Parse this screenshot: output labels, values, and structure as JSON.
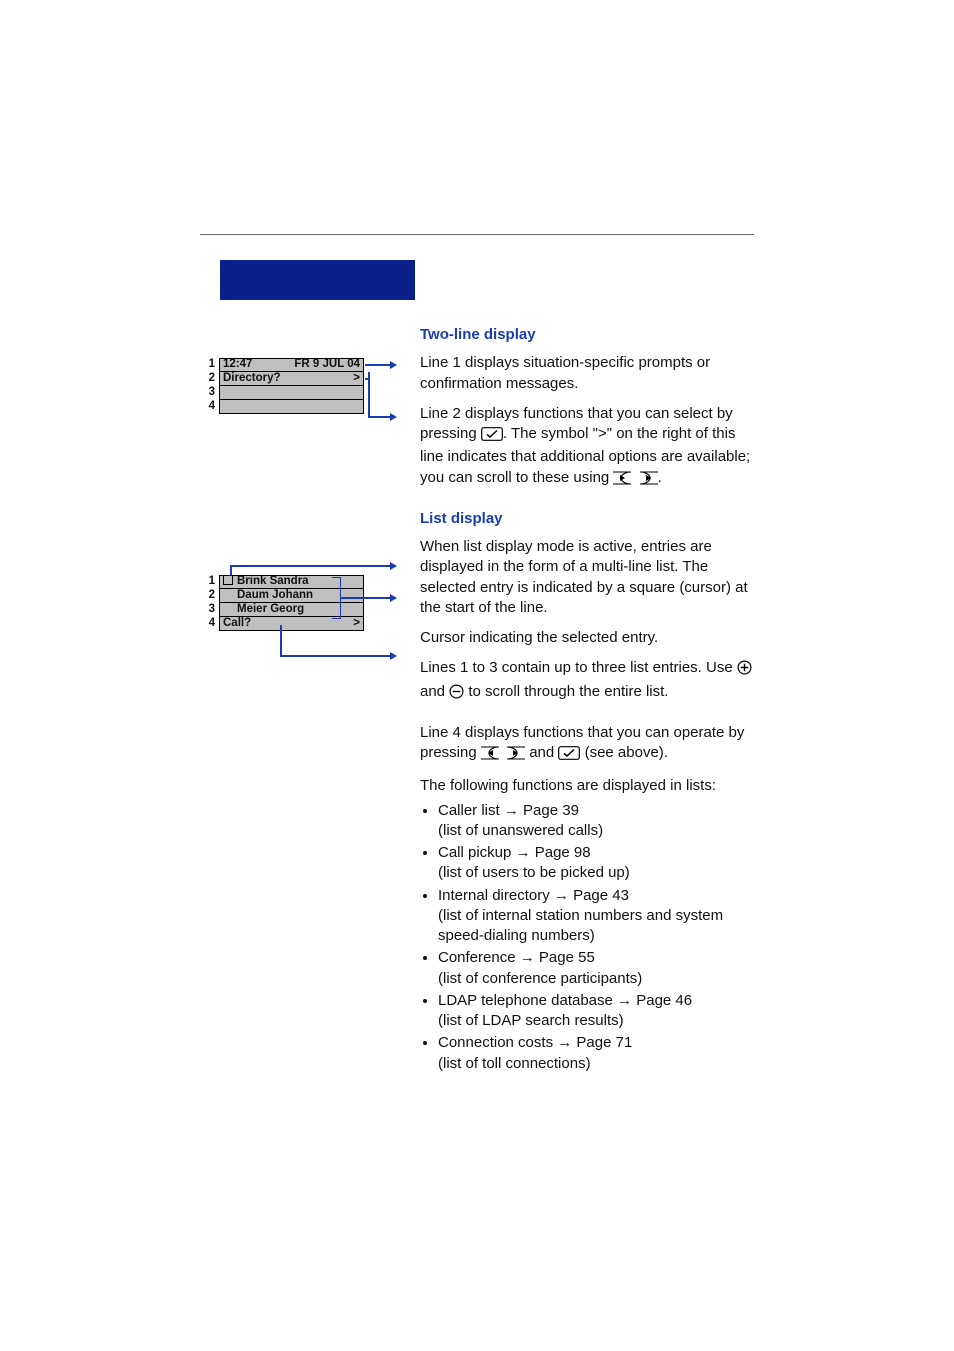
{
  "headings": {
    "two_line": "Two-line display",
    "list_display": "List display"
  },
  "two_line": {
    "p1": "Line 1 displays situation-specific prompts or confirmation messages.",
    "p2a": "Line 2 displays functions that you can select by pressing ",
    "p2b": ". The symbol \">\" on the right of this line indicates that additional options are available; you can scroll to these using ",
    "p2c": "."
  },
  "list": {
    "intro": "When list display mode is active, entries are displayed in the form of a multi-line list. The selected entry is indicated by a square (cursor) at the start of the line.",
    "cursor_note": "Cursor indicating the selected entry.",
    "lines_a": "Lines 1 to 3 contain up to three list entries. Use ",
    "lines_b": " and ",
    "lines_c": " to scroll through the entire list.",
    "line4_a": "Line 4 displays functions that you can operate by pressing ",
    "line4_b": " and ",
    "line4_c": " (see above).",
    "funcs_lead": "The following functions are displayed in lists:",
    "items": [
      {
        "label": "Caller list",
        "page": "Page 39",
        "desc": "(list of unanswered calls)"
      },
      {
        "label": "Call pickup",
        "page": "Page 98",
        "desc": "(list of users to be picked up)"
      },
      {
        "label": "Internal directory",
        "page": "Page 43",
        "desc": "(list of internal station numbers and system speed-dialing numbers)"
      },
      {
        "label": "Conference",
        "page": "Page 55",
        "desc": "(list of conference participants)"
      },
      {
        "label": "LDAP telephone database",
        "page": "Page 46",
        "desc": "(list of LDAP search results)"
      },
      {
        "label": "Connection costs",
        "page": "Page 71",
        "desc": "(list of toll connections)"
      }
    ]
  },
  "fig1": {
    "rows": [
      "1",
      "2",
      "3",
      "4"
    ],
    "time": "12:47",
    "date": "FR 9 JUL 04",
    "line2_left": "Directory?",
    "line2_right": ">"
  },
  "fig2": {
    "rows": [
      "1",
      "2",
      "3",
      "4"
    ],
    "entry1": "Brink Sandra",
    "entry2": "Daum Johann",
    "entry3": "Meier Georg",
    "line4_left": "Call?",
    "line4_right": ">"
  },
  "arrow_glyph": "→"
}
